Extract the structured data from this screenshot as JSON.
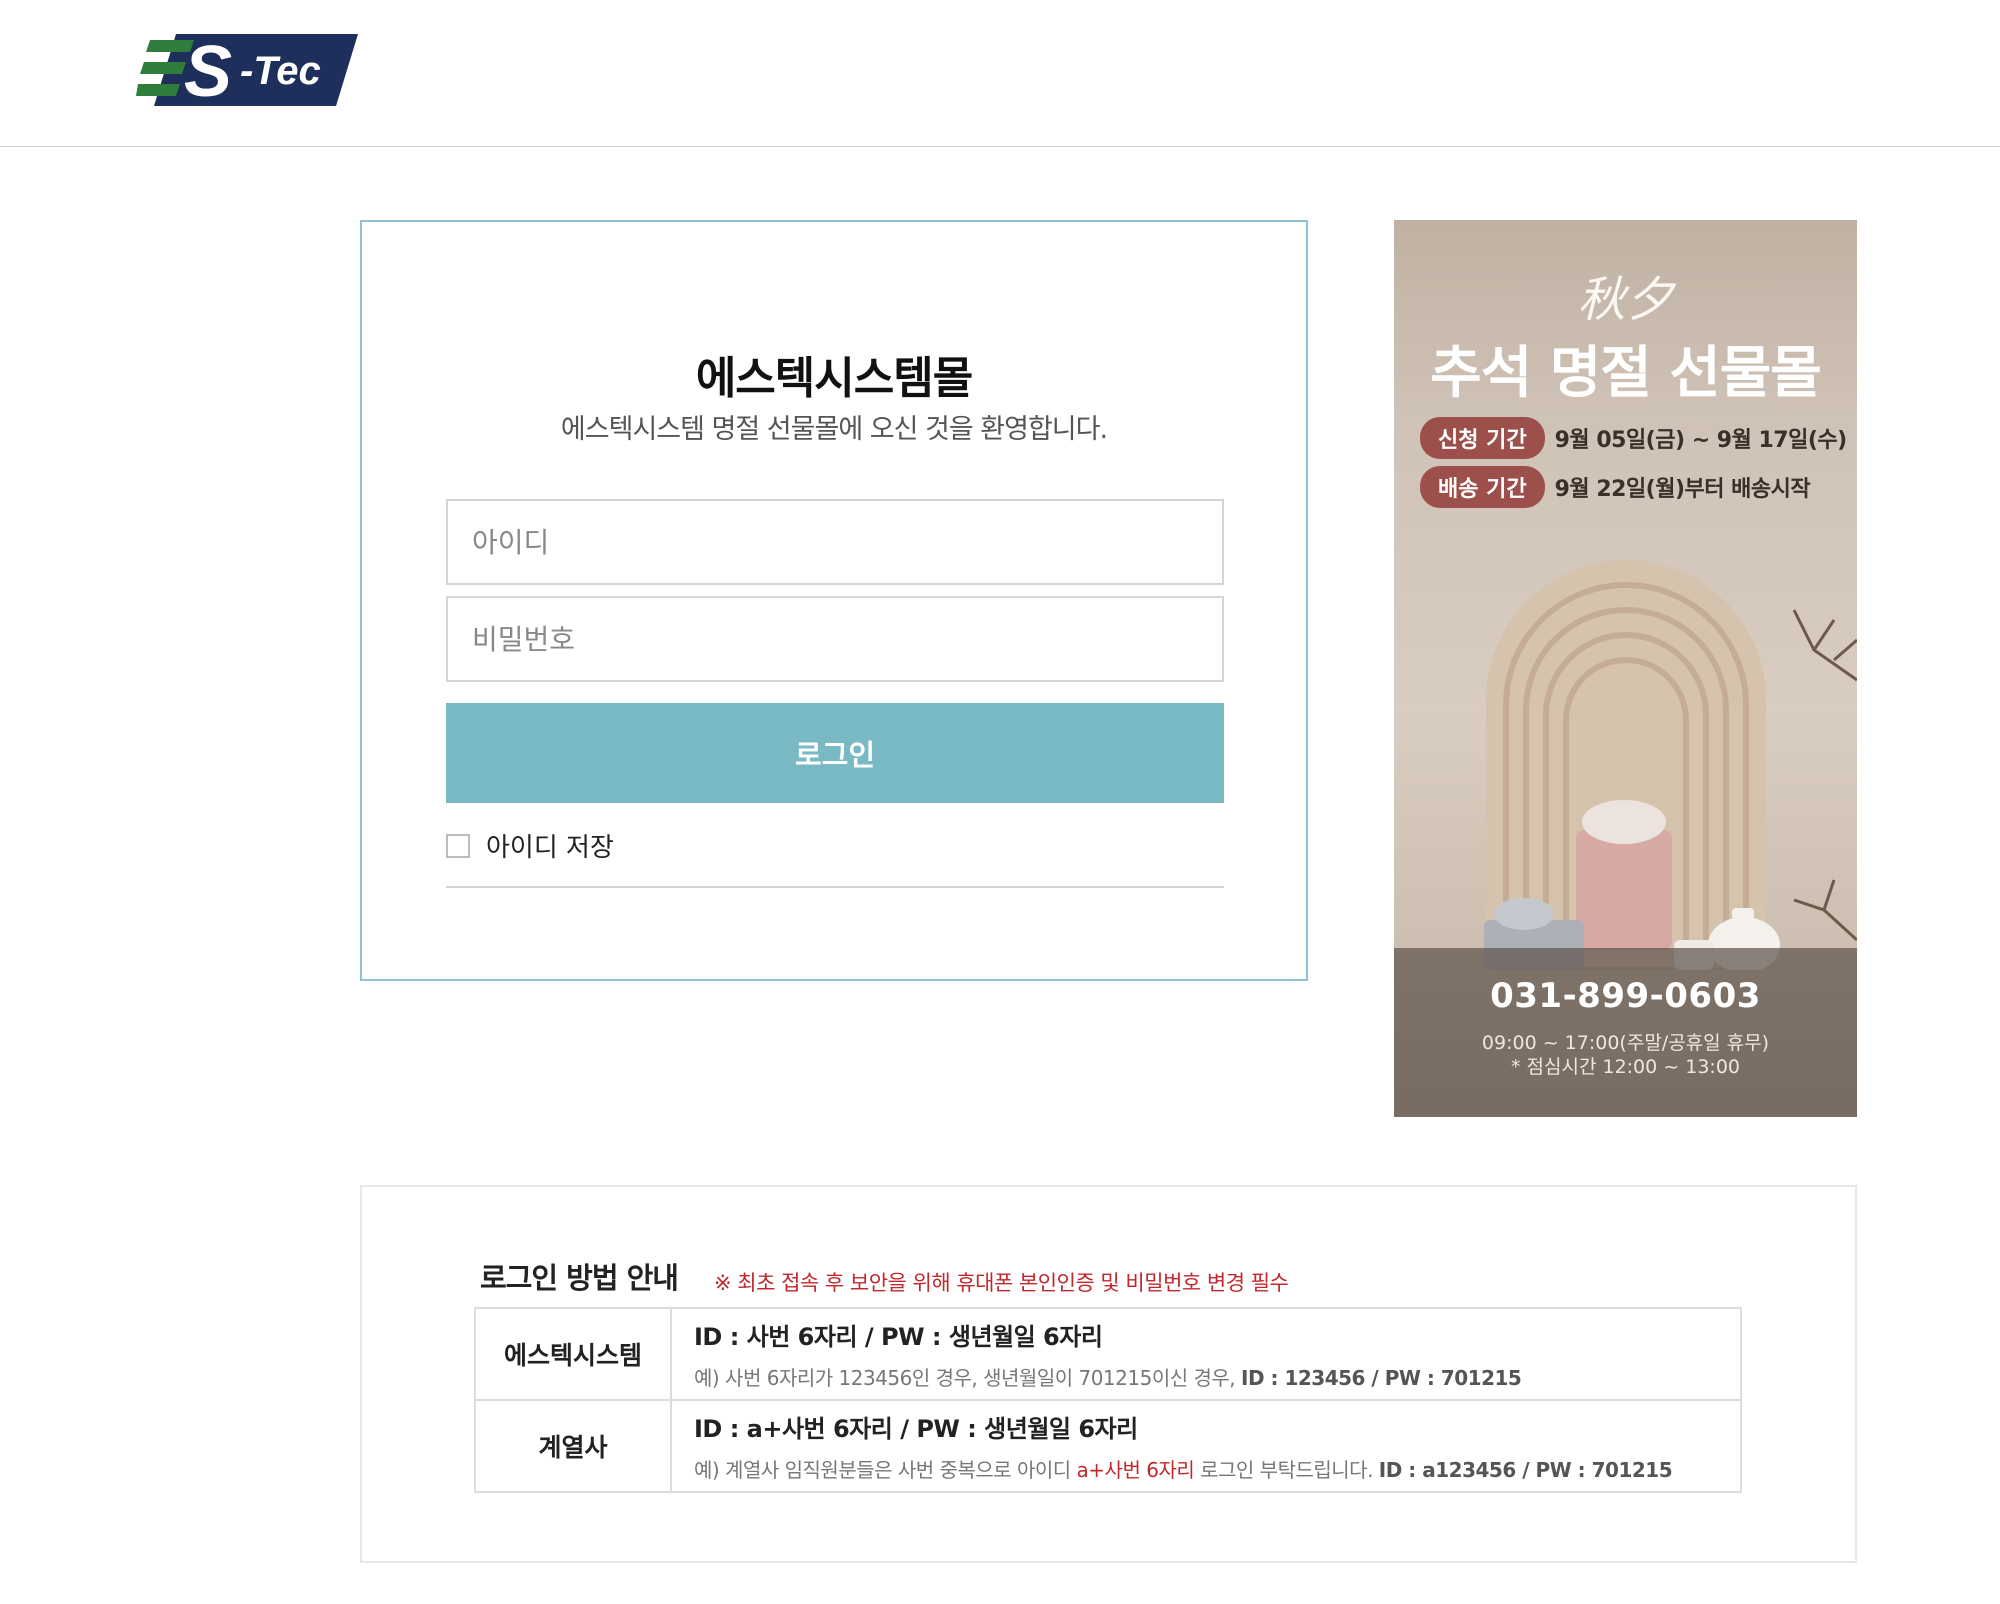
{
  "header": {
    "logo_text": "S-Tec",
    "logo_colors": {
      "green": "#2e7d3a",
      "navy": "#1f2f5c",
      "white": "#ffffff"
    }
  },
  "login": {
    "title": "에스텍시스템몰",
    "subtitle": "에스텍시스템 명절 선물몰에 오신 것을 환영합니다.",
    "id_placeholder": "아이디",
    "pw_placeholder": "비밀번호",
    "login_button": "로그인",
    "remember_label": "아이디 저장",
    "remember_checked": false,
    "accent_color": "#79b9c4"
  },
  "banner": {
    "hanja": "秋夕",
    "title": "추석 명절 선물몰",
    "period_label": "신청 기간",
    "period_value": "9월 05일(금) ~ 9월 17일(수)",
    "delivery_label": "배송 기간",
    "delivery_value": "9월 22일(월)부터 배송시작",
    "phone": "031-899-0603",
    "hours": "09:00 ~ 17:00(주말/공휴일 휴무)",
    "lunch": "* 점심시간 12:00 ~ 13:00",
    "pill_color": "#9c4f4b"
  },
  "guide": {
    "title": "로그인 방법 안내",
    "note": "※ 최초 접속 후 보안을 위해 휴대폰 본인인증 및 비밀번호 변경 필수",
    "rows": [
      {
        "head": "에스텍시스템",
        "main": "ID : 사번 6자리  /  PW : 생년월일 6자리",
        "example_prefix": "예) 사번 6자리가 123456인 경우, 생년월일이 701215이신 경우, ",
        "example_highlight": "",
        "example_suffix": "",
        "example_bold": "ID : 123456 / PW : 701215"
      },
      {
        "head": "계열사",
        "main": "ID : a+사번 6자리  /  PW : 생년월일 6자리",
        "example_prefix": "예) 계열사 임직원분들은 사번 중복으로 아이디 ",
        "example_highlight": "a+사번 6자리",
        "example_suffix": " 로그인 부탁드립니다. ",
        "example_bold": "ID : a123456 / PW : 701215"
      }
    ]
  }
}
